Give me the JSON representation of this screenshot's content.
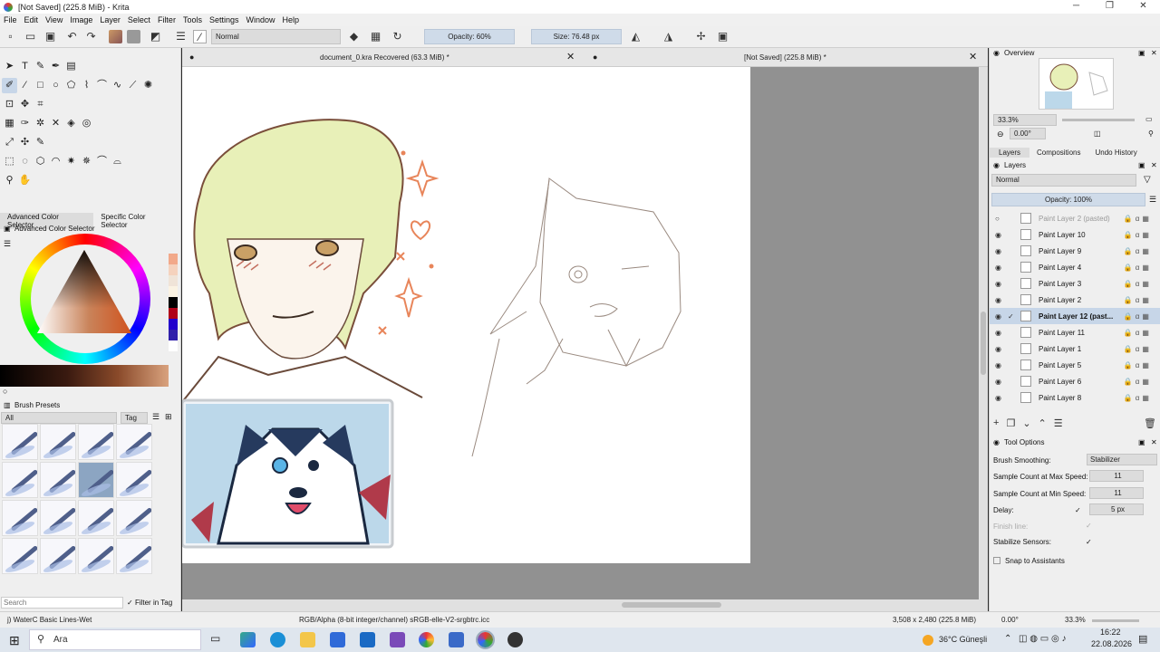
{
  "window": {
    "title": "[Not Saved]  (225.8 MiB) - Krita",
    "buttons": [
      "─",
      "❐",
      "✕"
    ]
  },
  "menu": [
    "File",
    "Edit",
    "View",
    "Image",
    "Layer",
    "Select",
    "Filter",
    "Tools",
    "Settings",
    "Window",
    "Help"
  ],
  "toolbar": {
    "blend_mode": "Normal",
    "opacity": "Opacity: 60%",
    "size": "Size: 76.48 px"
  },
  "left_dock": {
    "color_tabs": [
      "Advanced Color Selector",
      "Specific Color Selector"
    ],
    "color_header": "Advanced Color Selector",
    "brush_header": "Brush Presets",
    "brush_filter": "All",
    "tag_label": "Tag",
    "search_placeholder": "Search",
    "filter_in_tag": "Filter in Tag"
  },
  "canvas": {
    "tabs": [
      "document_0.kra Recovered (63.3 MiB) *",
      "[Not Saved]  (225.8 MiB) *"
    ]
  },
  "overview": {
    "header": "Overview",
    "zoom": "33.3%",
    "rotation": "0.00°"
  },
  "layers_dock": {
    "tabs": [
      "Layers",
      "Compositions",
      "Undo History"
    ],
    "header": "Layers",
    "blend_mode": "Normal",
    "opacity": "Opacity: 100%",
    "layers": [
      {
        "name": "Paint Layer 2 (pasted)",
        "visible": false,
        "active": false
      },
      {
        "name": "Paint Layer 10",
        "visible": true,
        "active": false
      },
      {
        "name": "Paint Layer 9",
        "visible": true,
        "active": false
      },
      {
        "name": "Paint Layer 4",
        "visible": true,
        "active": false
      },
      {
        "name": "Paint Layer 3",
        "visible": true,
        "active": false
      },
      {
        "name": "Paint Layer 2",
        "visible": true,
        "active": false
      },
      {
        "name": "Paint Layer 12 (past...",
        "visible": true,
        "active": true
      },
      {
        "name": "Paint Layer 11",
        "visible": true,
        "active": false
      },
      {
        "name": "Paint Layer 1",
        "visible": true,
        "active": false
      },
      {
        "name": "Paint Layer 5",
        "visible": true,
        "active": false
      },
      {
        "name": "Paint Layer 6",
        "visible": true,
        "active": false
      },
      {
        "name": "Paint Layer 8",
        "visible": true,
        "active": false
      }
    ]
  },
  "tool_options": {
    "header": "Tool Options",
    "brush_smoothing_label": "Brush Smoothing:",
    "brush_smoothing_value": "Stabilizer",
    "max_speed_label": "Sample Count at Max Speed:",
    "max_speed_value": "11",
    "min_speed_label": "Sample Count at Min Speed:",
    "min_speed_value": "11",
    "delay_label": "Delay:",
    "delay_value": "5 px",
    "finish_line_label": "Finish line:",
    "stabilize_sensors_label": "Stabilize Sensors:",
    "snap_label": "Snap to Assistants"
  },
  "status": {
    "brush": "j) WaterC Basic Lines-Wet",
    "color_profile": "RGB/Alpha (8-bit integer/channel)  sRGB-elle-V2-srgbtrc.icc",
    "dimensions": "3,508 x 2,480 (225.8 MiB)",
    "rotation": "0.00°",
    "zoom": "33.3%"
  },
  "taskbar": {
    "search": "Ara",
    "weather": "36°C  Güneşli",
    "time": "16:22",
    "date": "22.08.2026"
  },
  "colors": {
    "accent": "#c7d6e8",
    "panel": "#efefef",
    "canvas_bg": "#919191"
  }
}
